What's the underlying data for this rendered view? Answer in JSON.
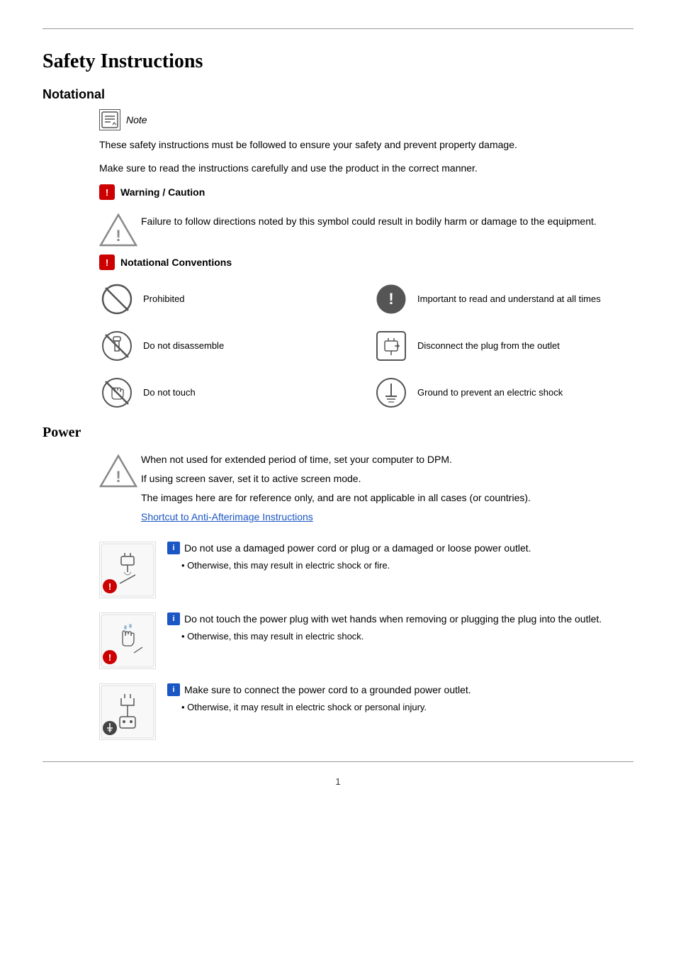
{
  "page": {
    "title": "Safety Instructions",
    "page_number": "1"
  },
  "notational": {
    "heading": "Notational",
    "note_label": "Note",
    "body1": "These safety instructions must be followed to ensure your safety and prevent property damage.",
    "body2": "Make sure to read the instructions carefully and use the product in the correct manner.",
    "warning_label": "Warning / Caution",
    "warning_text": "Failure to follow directions noted by this symbol could result in bodily harm or damage to the equipment.",
    "conventions_heading": "Notational Conventions",
    "conventions": [
      {
        "label": "Prohibited"
      },
      {
        "label": "Important to read and understand at all times"
      },
      {
        "label": "Do not disassemble"
      },
      {
        "label": "Disconnect the plug from the outlet"
      },
      {
        "label": "Do not touch"
      },
      {
        "label": "Ground to prevent an electric shock"
      }
    ]
  },
  "power": {
    "heading": "Power",
    "warning1": "When not used for extended period of time, set your computer to DPM.",
    "warning2": "If using screen saver, set it to active screen mode.",
    "warning3": "The images here are for reference only, and are not applicable in all cases (or countries).",
    "shortcut_text": "Shortcut to Anti-Afterimage Instructions",
    "items": [
      {
        "icon_label": "i",
        "title": "Do not use a damaged power cord or plug or a damaged or loose power outlet.",
        "bullet": "Otherwise, this may result in electric shock or fire."
      },
      {
        "icon_label": "i",
        "title": "Do not touch the power plug with wet hands when removing or plugging the plug into the outlet.",
        "bullet": "Otherwise, this may result in electric shock."
      },
      {
        "icon_label": "i",
        "title": "Make sure to connect the power cord to a grounded power outlet.",
        "bullet": "Otherwise, it may result in electric shock or personal injury."
      }
    ]
  }
}
